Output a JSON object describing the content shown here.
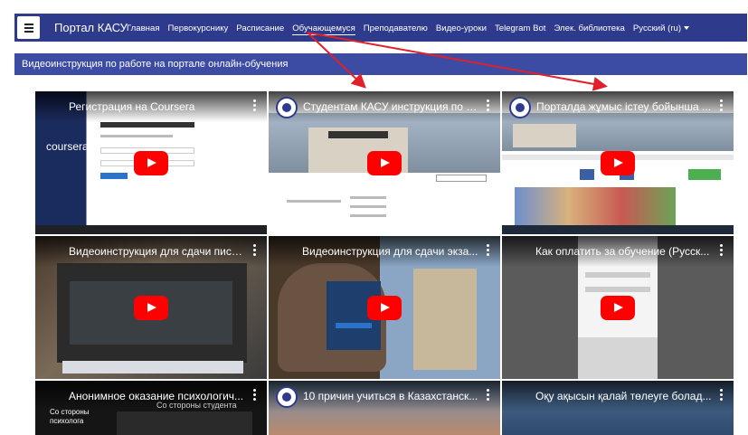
{
  "navbar": {
    "brand": "Портал КАСУ",
    "links": [
      "Главная",
      "Первокурснику",
      "Расписание",
      "Обучающемуся",
      "Преподавателю",
      "Видео-уроки",
      "Telegram Bot",
      "Элек. библиотека"
    ],
    "language": "Русский (ru)"
  },
  "section": {
    "title": "Видеоинструкция по работе на портале онлайн-обучения"
  },
  "videos": [
    {
      "title": "Регистрация на Coursera",
      "thumb_label": "coursera"
    },
    {
      "title": "Студентам КАСУ инструкция по р..."
    },
    {
      "title": "Порталда жұмыс істеу бойынша ..."
    },
    {
      "title": "Видеоинструкция для сдачи пись..."
    },
    {
      "title": "Видеоинструкция для сдачи экза..."
    },
    {
      "title": "Как оплатить за обучение (Русск..."
    },
    {
      "title": "Анонимное оказание психологич...",
      "thumb_label": "Со стороны психолога",
      "thumb_label2": "Со стороны студента"
    },
    {
      "title": "10 причин учиться в Казахстанск..."
    },
    {
      "title": "Оқу ақысын қалай төлеуге болад..."
    }
  ],
  "colors": {
    "navbar": "#2e3a8c",
    "section": "#3c4ca4",
    "play": "#ff0000",
    "annotation": "#e0202a"
  }
}
